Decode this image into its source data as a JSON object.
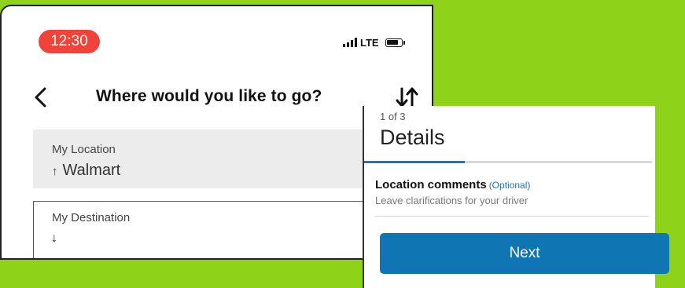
{
  "status_bar": {
    "time": "12:30",
    "network": "LTE"
  },
  "header": {
    "title": "Where would you like to go?"
  },
  "origin": {
    "label": "My Location",
    "arrow": "↑",
    "value": "Walmart"
  },
  "destination": {
    "label": "My Destination",
    "arrow": "↓"
  },
  "details": {
    "step": "1 of 3",
    "title": "Details",
    "progress": 0.35,
    "comments_label": "Location comments",
    "comments_optional": "(Optional)",
    "comments_help": "Leave clarifications for your driver",
    "next_label": "Next"
  },
  "colors": {
    "background": "#8fd21a",
    "time_pill": "#f0443a",
    "primary": "#0f75b3",
    "link": "#1a75c4"
  },
  "icons": [
    "back-arrow-icon",
    "swap-direction-icon",
    "signal-icon",
    "battery-icon"
  ]
}
